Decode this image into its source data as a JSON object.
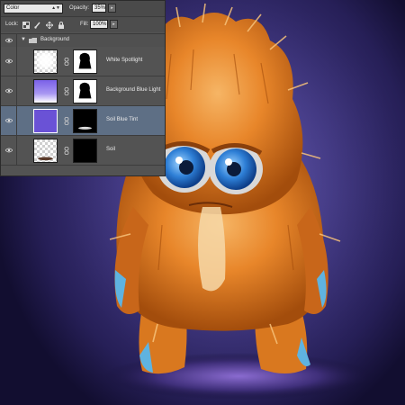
{
  "layers_panel": {
    "blend_mode": "Color",
    "opacity_label": "Opacity:",
    "opacity_value": "35%",
    "lock_label": "Lock:",
    "fill_label": "Fill:",
    "fill_value": "100%",
    "group": {
      "name": "Background",
      "icon": "folder-icon"
    },
    "layers": [
      {
        "name": "White Spotlight",
        "selected": false
      },
      {
        "name": "Background Blue Light",
        "selected": false
      },
      {
        "name": "Soil Blue Tint",
        "selected": true
      },
      {
        "name": "Soil",
        "selected": false
      }
    ]
  },
  "colors": {
    "canvas_purple": "#3f367e",
    "fur_orange": "#e8862a",
    "eye_blue": "#2e7fd6",
    "panel_gray": "#535353",
    "selection_blue": "#5e6f85",
    "tint_purple": "#6a52d6"
  }
}
